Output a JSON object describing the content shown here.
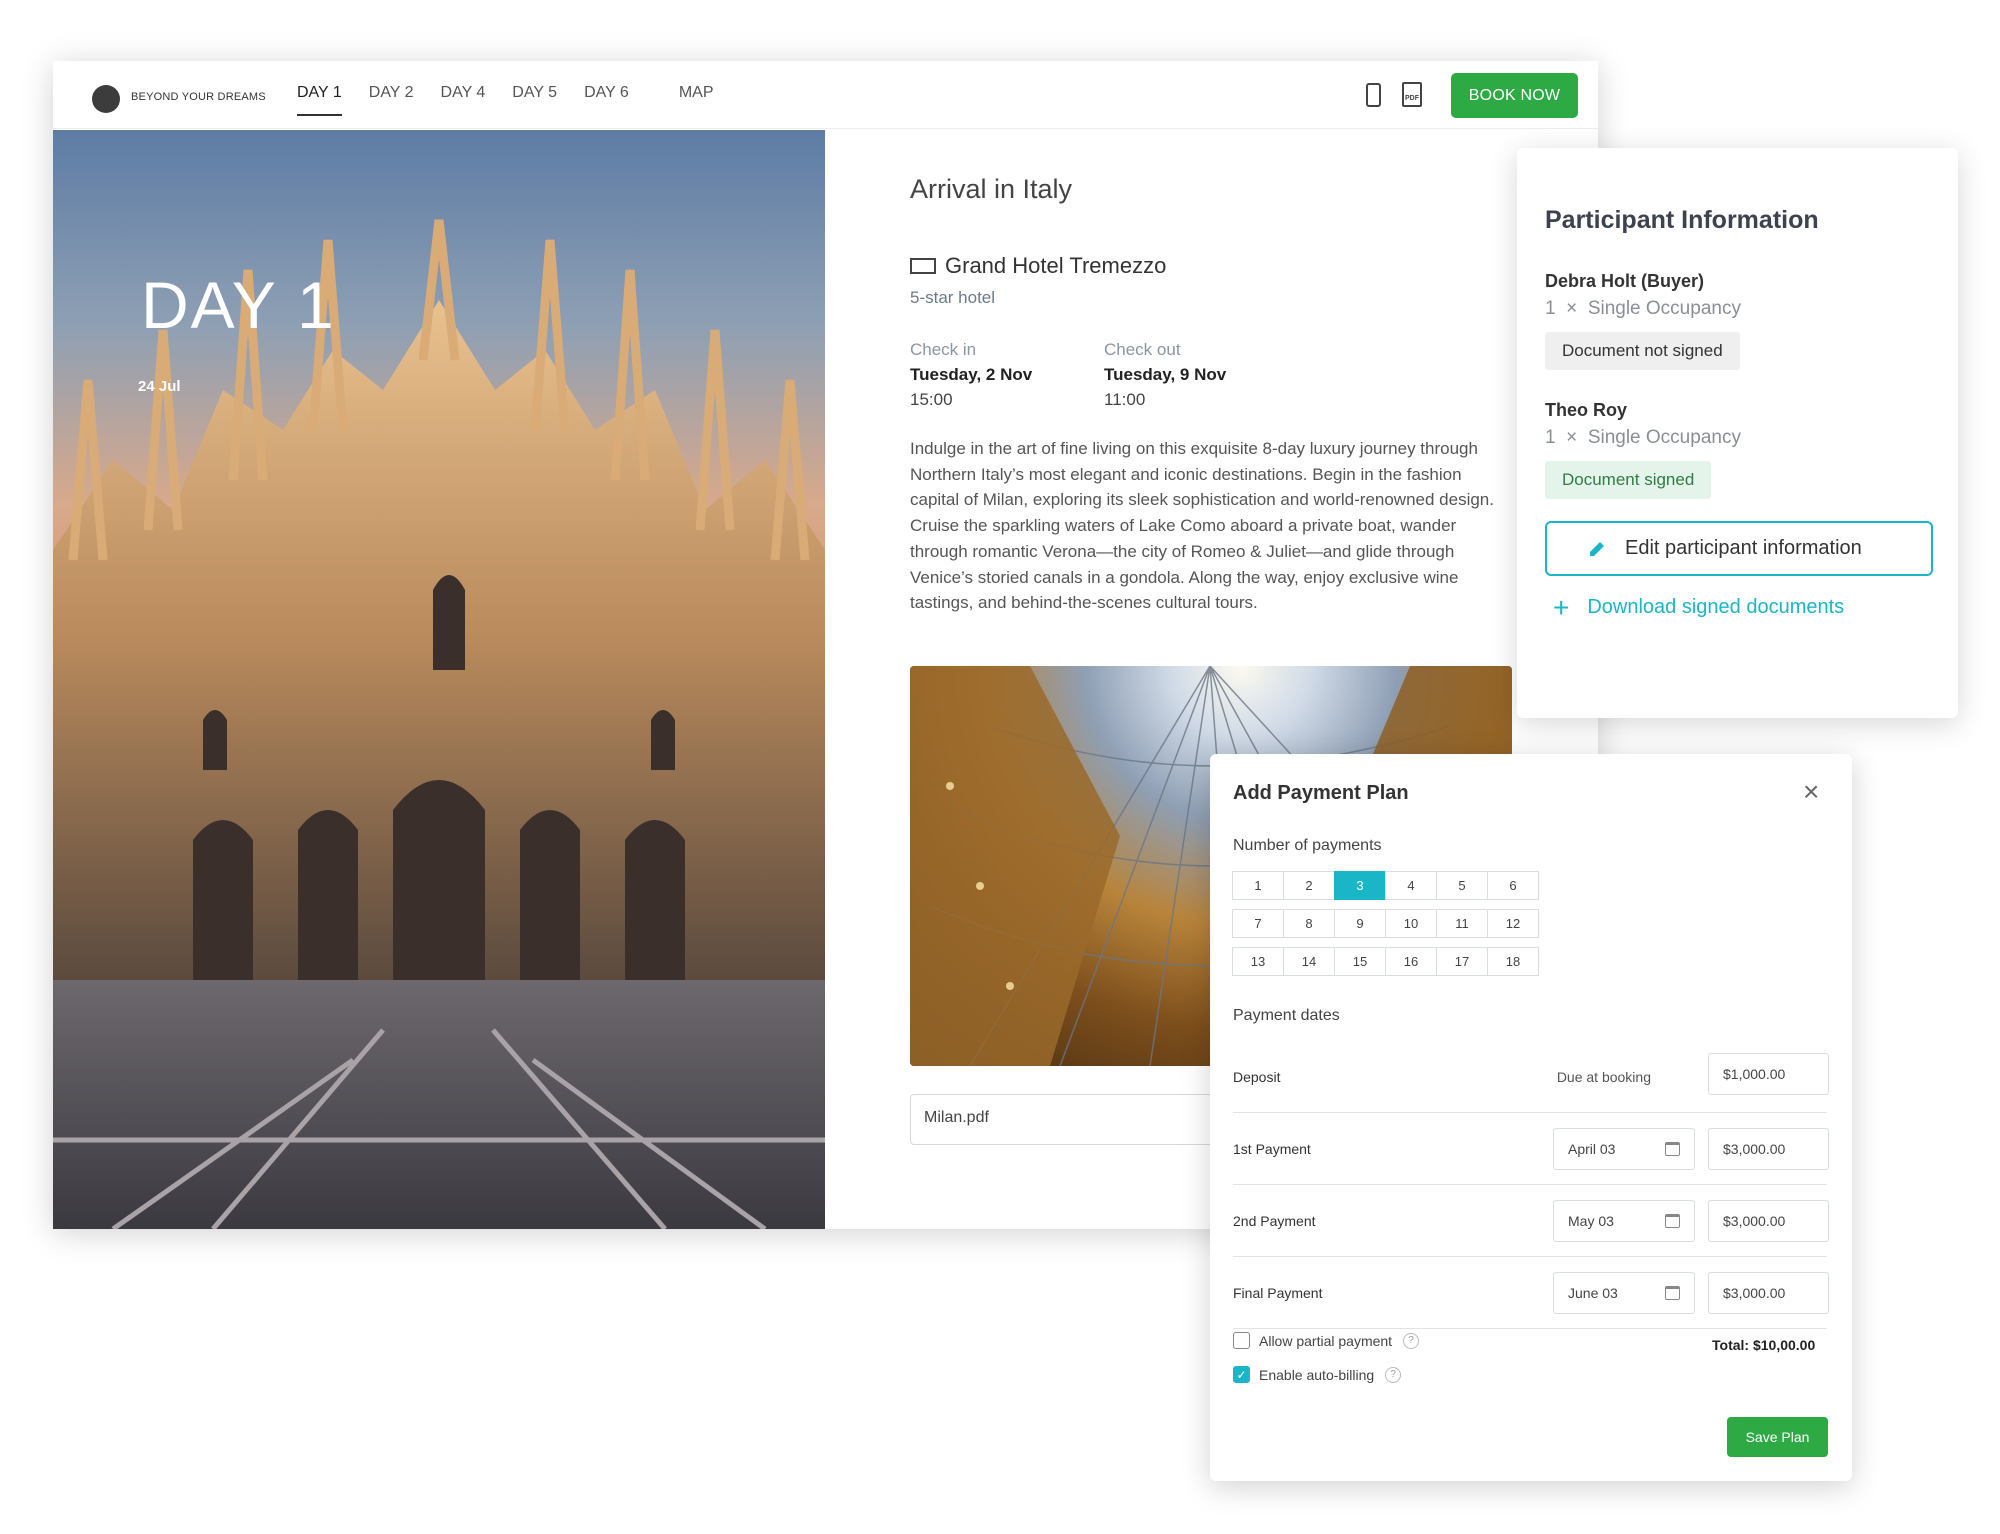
{
  "brand": "BEYOND YOUR DREAMS",
  "tabs": [
    {
      "label": "DAY 1",
      "active": true
    },
    {
      "label": "DAY 2"
    },
    {
      "label": "DAY 4"
    },
    {
      "label": "DAY 5"
    },
    {
      "label": "DAY 6"
    },
    {
      "label": "MAP"
    }
  ],
  "toolbar": {
    "phone_icon": "mobile-phone-icon",
    "pdf_icon": "pdf-icon",
    "pdf_label": "PDF",
    "book_label": "BOOK NOW"
  },
  "hero": {
    "day_title": "DAY 1",
    "date": "24 Jul"
  },
  "content": {
    "title": "Arrival in Italy",
    "hotel_icon": "bed-icon",
    "hotel_name": "Grand Hotel Tremezzo",
    "hotel_class": "5-star hotel",
    "check_in": {
      "label": "Check in",
      "day": "Tuesday, 2 Nov",
      "time": "15:00"
    },
    "check_out": {
      "label": "Check out",
      "day": "Tuesday, 9 Nov",
      "time": "11:00"
    },
    "description": "Indulge in the art of fine living on this exquisite 8-day luxury journey through Northern Italy’s most elegant and iconic destinations. Begin in the fashion capital of Milan, exploring its sleek sophistication and world-renowned design. Cruise the sparkling waters of Lake Como aboard a private boat, wander through romantic Verona—the city of Romeo & Juliet—and glide through Venice’s storied canals in a gondola. Along the way, enjoy exclusive wine tastings, and behind-the-scenes cultural tours.",
    "file_name": "Milan.pdf"
  },
  "participants": {
    "title": "Participant Information",
    "people": [
      {
        "name": "Debra Holt (Buyer)",
        "quantity": "1",
        "times": "×",
        "occupancy": "Single Occupancy",
        "status": "Document not signed",
        "signed": false
      },
      {
        "name": "Theo Roy",
        "quantity": "1",
        "times": "×",
        "occupancy": "Single Occupancy",
        "status": "Document signed",
        "signed": true
      }
    ],
    "edit_label": "Edit participant information",
    "download_label": "Download signed documents"
  },
  "payment_plan": {
    "title": "Add Payment Plan",
    "close_icon": "close-icon",
    "number_label": "Number of payments",
    "numbers": [
      "1",
      "2",
      "3",
      "4",
      "5",
      "6",
      "7",
      "8",
      "9",
      "10",
      "11",
      "12",
      "13",
      "14",
      "15",
      "16",
      "17",
      "18"
    ],
    "selected_number": "3",
    "dates_label": "Payment dates",
    "rows": [
      {
        "name": "Deposit",
        "due": "Due at booking",
        "date": "",
        "amount": "$1,000.00"
      },
      {
        "name": "1st Payment",
        "due": "",
        "date": "April 03",
        "amount": "$3,000.00"
      },
      {
        "name": "2nd Payment",
        "due": "",
        "date": "May 03",
        "amount": "$3,000.00"
      },
      {
        "name": "Final Payment",
        "due": "",
        "date": "June 03",
        "amount": "$3,000.00"
      }
    ],
    "partial_label": "Allow partial payment",
    "partial_checked": false,
    "autobill_label": "Enable auto-billing",
    "autobill_checked": true,
    "help_glyph": "?",
    "total": "Total: $10,00.00",
    "save_label": "Save Plan"
  },
  "colors": {
    "accent": "#19b6c8",
    "primary_green": "#2eaa45"
  }
}
